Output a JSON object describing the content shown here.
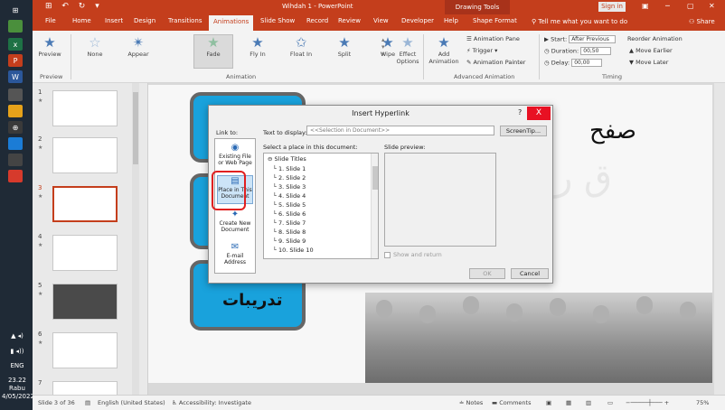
{
  "taskbar": {
    "time": "23.22",
    "day": "Rabu",
    "date": "4/05/2022",
    "lang": "ENG"
  },
  "titlebar": {
    "document": "Wihdah 1 - PowerPoint",
    "contextual": "Drawing Tools",
    "signin": "Sign in"
  },
  "tabs": [
    "File",
    "Home",
    "Insert",
    "Design",
    "Transitions",
    "Animations",
    "Slide Show",
    "Record",
    "Review",
    "View",
    "Developer",
    "Help",
    "Shape Format"
  ],
  "active_tab": "Animations",
  "tellme": "Tell me what you want to do",
  "share": "Share",
  "ribbon": {
    "preview": "Preview",
    "preview_group": "Preview",
    "animations": [
      "None",
      "Appear",
      "Fade",
      "Fly In",
      "Float In",
      "Split",
      "Wipe"
    ],
    "effect_options": "Effect Options",
    "animation_group": "Animation",
    "add_animation": "Add Animation",
    "animation_pane": "Animation Pane",
    "trigger": "Trigger",
    "animation_painter": "Animation Painter",
    "advanced_group": "Advanced Animation",
    "start_label": "Start:",
    "start_value": "After Previous",
    "duration_label": "Duration:",
    "duration_value": "00,50",
    "delay_label": "Delay:",
    "delay_value": "00,00",
    "reorder": "Reorder Animation",
    "move_earlier": "Move Earlier",
    "move_later": "Move Later",
    "timing_group": "Timing"
  },
  "thumbnails": [
    "1",
    "2",
    "3",
    "4",
    "5",
    "6",
    "7"
  ],
  "slide": {
    "arabic_title": "صفح",
    "arabic_label": "تدريبات"
  },
  "dialog": {
    "title": "Insert Hyperlink",
    "help": "?",
    "close": "X",
    "link_to": "Link to:",
    "text_to_display_label": "Text to display:",
    "text_to_display_value": "<<Selection in Document>>",
    "screentip": "ScreenTip...",
    "link_options": [
      {
        "label": "Existing File or Web Page",
        "icon": "web-page-icon"
      },
      {
        "label": "Place in This Document",
        "icon": "document-place-icon"
      },
      {
        "label": "Create New Document",
        "icon": "new-document-icon"
      },
      {
        "label": "E-mail Address",
        "icon": "email-icon"
      }
    ],
    "select_place_label": "Select a place in this document:",
    "slide_preview_label": "Slide preview:",
    "places": [
      "Slide Titles",
      "1. Slide 1",
      "2. Slide 2",
      "3. Slide 3",
      "4. Slide 4",
      "5. Slide 5",
      "6. Slide 6",
      "7. Slide 7",
      "8. Slide 8",
      "9. Slide 9",
      "10. Slide 10"
    ],
    "show_and_return": "Show and return",
    "ok": "OK",
    "cancel": "Cancel"
  },
  "statusbar": {
    "slide_of": "Slide 3 of 36",
    "language": "English (United States)",
    "accessibility": "Accessibility: Investigate",
    "notes": "Notes",
    "comments": "Comments",
    "zoom": "75%"
  }
}
